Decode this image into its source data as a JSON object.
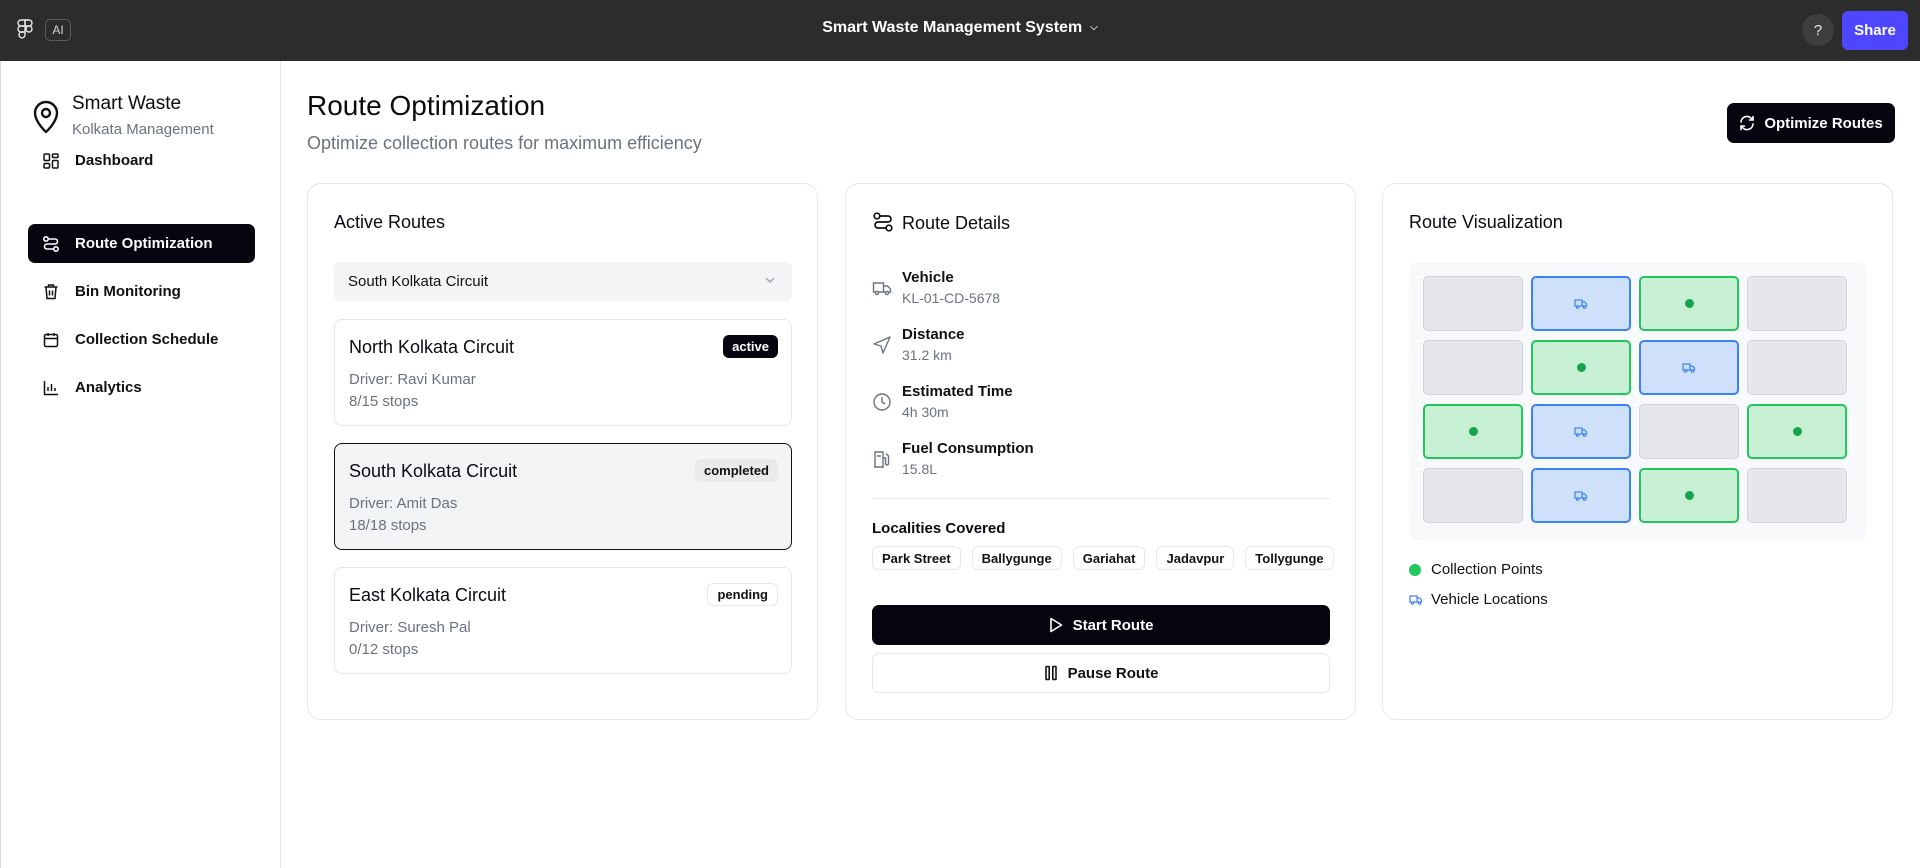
{
  "topbar": {
    "ai_label": "AI",
    "project_title": "Smart Waste Management System",
    "help_label": "?",
    "share_label": "Share"
  },
  "sidebar": {
    "brand_name": "Smart Waste",
    "brand_sub": "Kolkata Management",
    "items": [
      {
        "label": "Dashboard",
        "icon": "dashboard-icon"
      },
      {
        "label": "Route Optimization",
        "icon": "route-icon",
        "active": true
      },
      {
        "label": "Bin Monitoring",
        "icon": "trash-icon"
      },
      {
        "label": "Collection Schedule",
        "icon": "calendar-icon"
      },
      {
        "label": "Analytics",
        "icon": "bar-chart-icon"
      }
    ]
  },
  "main": {
    "title": "Route Optimization",
    "subtitle": "Optimize collection routes for maximum efficiency",
    "optimize_label": "Optimize Routes"
  },
  "active_routes": {
    "title": "Active Routes",
    "selected_route": "South Kolkata Circuit",
    "routes": [
      {
        "name": "North Kolkata Circuit",
        "driver": "Driver: Ravi Kumar",
        "stops": "8/15 stops",
        "status": "active"
      },
      {
        "name": "South Kolkata Circuit",
        "driver": "Driver: Amit Das",
        "stops": "18/18 stops",
        "status": "completed"
      },
      {
        "name": "East Kolkata Circuit",
        "driver": "Driver: Suresh Pal",
        "stops": "0/12 stops",
        "status": "pending"
      }
    ]
  },
  "route_details": {
    "title": "Route Details",
    "vehicle_label": "Vehicle",
    "vehicle_value": "KL-01-CD-5678",
    "distance_label": "Distance",
    "distance_value": "31.2 km",
    "time_label": "Estimated Time",
    "time_value": "4h 30m",
    "fuel_label": "Fuel Consumption",
    "fuel_value": "15.8L",
    "localities_label": "Localities Covered",
    "localities": [
      "Park Street",
      "Ballygunge",
      "Gariahat",
      "Jadavpur",
      "Tollygunge"
    ],
    "start_label": "Start Route",
    "pause_label": "Pause Route"
  },
  "visualization": {
    "title": "Route Visualization",
    "grid": [
      [
        "empty",
        "vehicle",
        "point",
        "empty"
      ],
      [
        "empty",
        "point",
        "vehicle",
        "empty"
      ],
      [
        "point",
        "vehicle",
        "empty",
        "point"
      ],
      [
        "empty",
        "vehicle",
        "point",
        "empty"
      ]
    ],
    "legend_points": "Collection Points",
    "legend_vehicles": "Vehicle Locations",
    "point_color": "#22c55e",
    "vehicle_color": "#3b82f6"
  }
}
